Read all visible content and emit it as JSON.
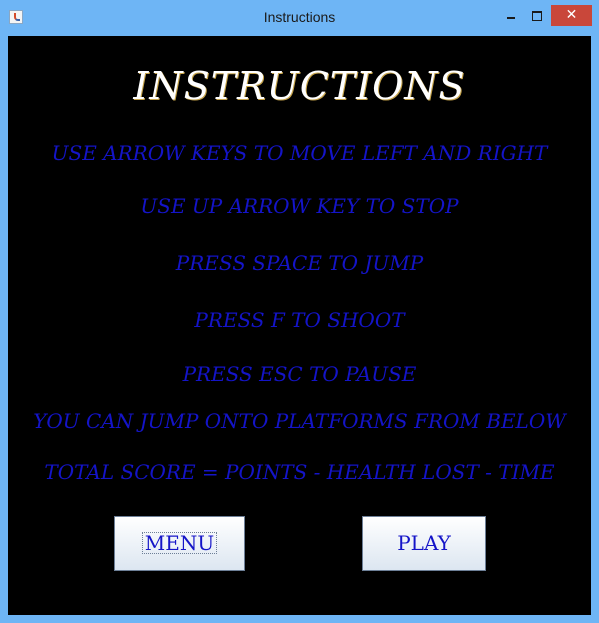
{
  "window": {
    "title": "Instructions",
    "close_glyph": "✕"
  },
  "content": {
    "heading": "INSTRUCTIONS",
    "instructions": [
      "USE ARROW KEYS TO MOVE LEFT AND RIGHT",
      "USE UP ARROW KEY TO STOP",
      "PRESS SPACE TO JUMP",
      "PRESS F TO SHOOT",
      "PRESS ESC TO PAUSE",
      "YOU CAN JUMP ONTO PLATFORMS FROM BELOW",
      "TOTAL SCORE = POINTS - HEALTH LOST - TIME"
    ],
    "buttons": {
      "menu": "MENU",
      "play": "PLAY"
    }
  },
  "colors": {
    "background": "#000000",
    "text_accent": "#1414c8",
    "heading": "#ffffff",
    "titlebar": "#6eb5f5",
    "close_button": "#c9473a"
  },
  "icons": {
    "app": "java-icon",
    "minimize": "minimize-icon",
    "maximize": "maximize-icon",
    "close": "close-icon"
  }
}
